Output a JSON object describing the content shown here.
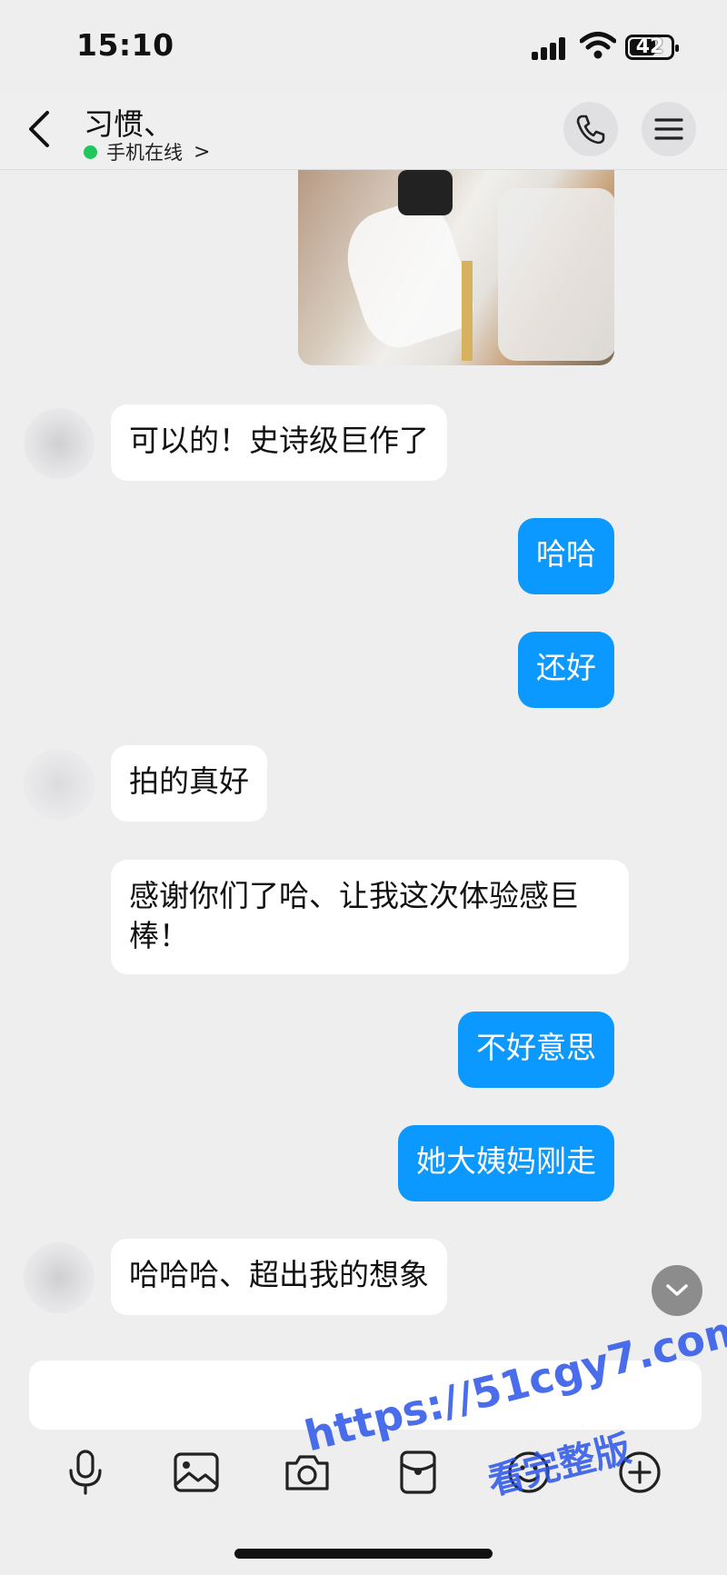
{
  "status": {
    "time": "15:10",
    "battery": "42"
  },
  "header": {
    "title": "习惯、",
    "status_text": "手机在线",
    "chevron": ">"
  },
  "messages": [
    {
      "side": "in",
      "text": "可以的！史诗级巨作了"
    },
    {
      "side": "out",
      "text": "哈哈"
    },
    {
      "side": "out",
      "text": "还好"
    },
    {
      "side": "in",
      "text": "拍的真好"
    },
    {
      "side": "in",
      "text": "感谢你们了哈、让我这次体验感巨棒！"
    },
    {
      "side": "out",
      "text": "不好意思"
    },
    {
      "side": "out",
      "text": "她大姨妈刚走"
    },
    {
      "side": "in",
      "text": "哈哈哈、超出我的想象"
    }
  ],
  "input": {
    "placeholder": ""
  },
  "toolbar": {
    "icons": [
      "mic-icon",
      "image-icon",
      "camera-icon",
      "red-packet-icon",
      "emoji-icon",
      "plus-icon"
    ]
  },
  "watermark": {
    "line1": "https://51cgy7.com",
    "line2": "看完整版"
  },
  "colors": {
    "accent": "#0b99ff",
    "online": "#22c55e",
    "background": "#eeeeef"
  }
}
